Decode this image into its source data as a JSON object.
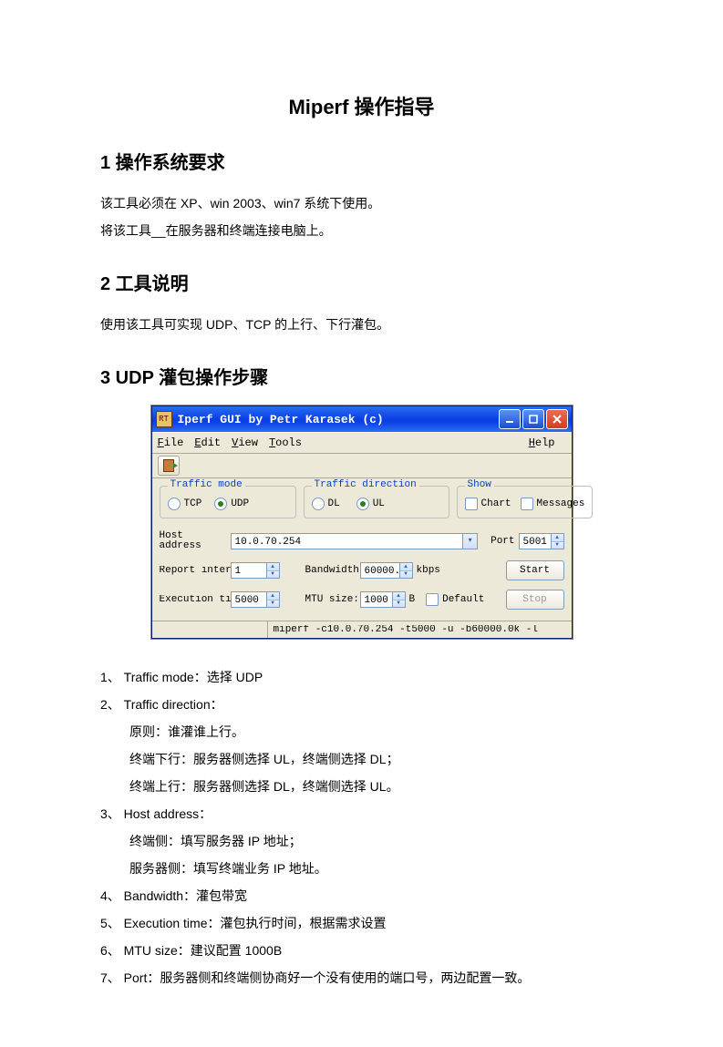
{
  "doc": {
    "title": "Miperf 操作指导",
    "s1_heading": "1   操作系统要求",
    "s1_p1": "该工具必须在 XP、win 2003、win7 系统下使用。",
    "s1_p2": "将该工具__在服务器和终端连接电脑上。",
    "s2_heading": "2   工具说明",
    "s2_p1": "使用该工具可实现 UDP、TCP  的上行、下行灌包。",
    "s3_heading": "3   UDP 灌包操作步骤",
    "li1": "1、 Traffic mode：选择 UDP",
    "li2": "2、 Traffic direction：",
    "li2a": "原则：谁灌谁上行。",
    "li2b": "终端下行：服务器侧选择 UL，终端侧选择 DL；",
    "li2c": "终端上行：服务器侧选择 DL，终端侧选择 UL。",
    "li3": "3、 Host address：",
    "li3a": "终端侧：填写服务器 IP 地址；",
    "li3b": "服务器侧：填写终端业务 IP 地址。",
    "li4": "4、 Bandwidth：灌包带宽",
    "li5": "5、 Execution time：灌包执行时间，根据需求设置",
    "li6": "6、 MTU size：建议配置 1000B",
    "li7": "7、 Port：服务器侧和终端侧协商好一个没有使用的端口号，两边配置一致。"
  },
  "win": {
    "title": "Iperf GUI by Petr Karasek (c)",
    "icon_text": "RT",
    "menu": {
      "file": "File",
      "edit": "Edit",
      "view": "View",
      "tools": "Tools",
      "help": "Help"
    },
    "groups": {
      "mode": "Traffic mode",
      "direction": "Traffic direction",
      "show": "Show"
    },
    "mode": {
      "tcp": "TCP",
      "udp": "UDP",
      "selected": "udp"
    },
    "direction": {
      "dl": "DL",
      "ul": "UL",
      "selected": "ul"
    },
    "show": {
      "chart": "Chart",
      "messages": "Messages"
    },
    "labels": {
      "host": "Host address",
      "port": "Port",
      "report": "Report interv:",
      "bandwidth": "Bandwidth:",
      "bw_unit": "kbps",
      "exec": "Execution tim",
      "mtu": "MTU size:",
      "mtu_unit": "B",
      "default": "Default",
      "start": "Start",
      "stop": "Stop"
    },
    "values": {
      "host": "10.0.70.254",
      "port": "5001",
      "report": "1",
      "bandwidth": "60000.",
      "exec": "5000",
      "mtu": "1000"
    },
    "status": "miperf -c10.0.70.254 -t5000 -u -b60000.0k -l"
  },
  "chart_data": null
}
